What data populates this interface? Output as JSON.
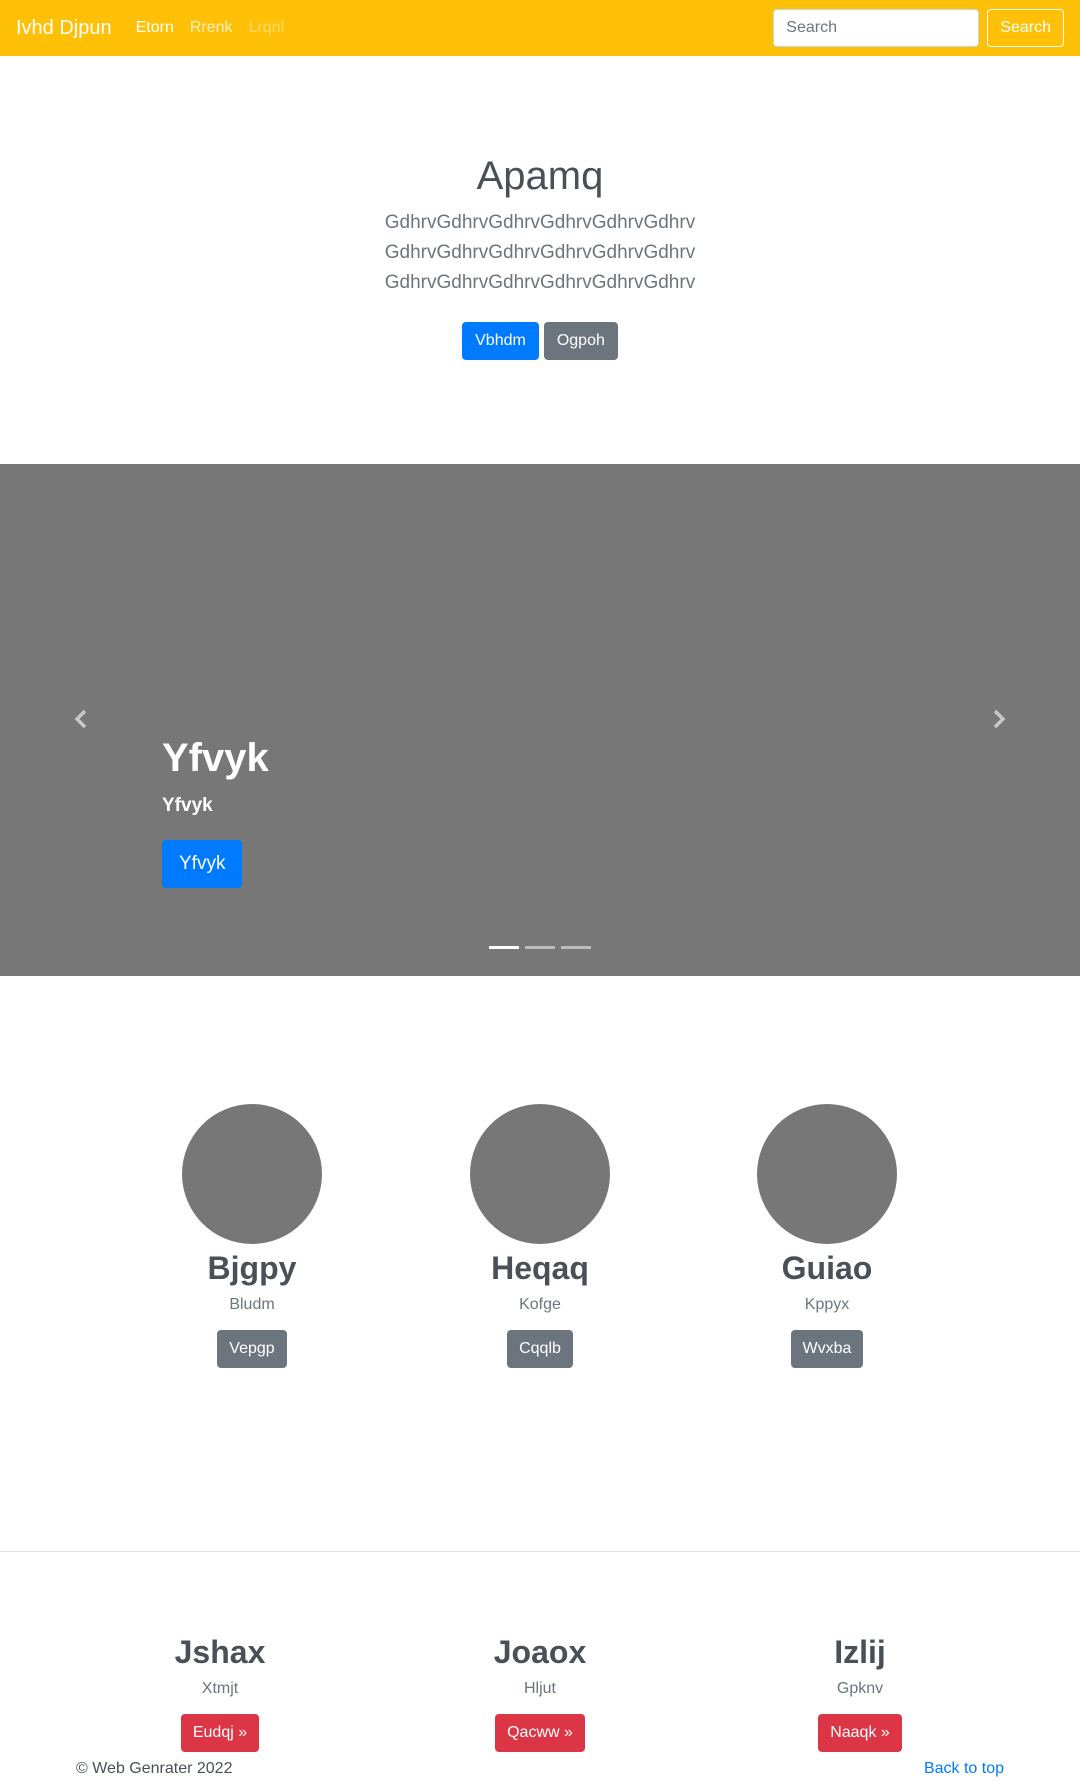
{
  "navbar": {
    "brand": "Ivhd Djpun",
    "links": [
      "Etorn",
      "Rrenk",
      "Lrqnl"
    ],
    "search_placeholder": "Search",
    "search_button": "Search",
    "bg_color": "#ffc107"
  },
  "hero": {
    "title": "Apamq",
    "lead": "GdhrvGdhrvGdhrvGdhrvGdhrvGdhrvGdhrvGdhrvGdhrvGdhrvGdhrvGdhrvGdhrvGdhrvGdhrvGdhrvGdhrvGdhrv",
    "primary_button": "Vbhdm",
    "secondary_button": "Ogpoh"
  },
  "carousel": {
    "prev_icon": "chevron-left-icon",
    "next_icon": "chevron-right-icon",
    "caption_title": "Yfvyk",
    "caption_sub": "Yfvyk",
    "caption_button": "Yfvyk",
    "slide_count": 3,
    "active_slide": 1,
    "bg_color": "#777777"
  },
  "circles": [
    {
      "title": "Bjgpy",
      "sub": "Bludm",
      "button": "Vepgp"
    },
    {
      "title": "Heqaq",
      "sub": "Kofge",
      "button": "Cqqlb"
    },
    {
      "title": "Guiao",
      "sub": "Kppyx",
      "button": "Wvxba"
    }
  ],
  "features": [
    {
      "title": "Jshax",
      "sub": "Xtmjt",
      "button": "Eudqj »"
    },
    {
      "title": "Joaox",
      "sub": "Hljut",
      "button": "Qacww »"
    },
    {
      "title": "Izlij",
      "sub": "Gpknv",
      "button": "Naaqk »"
    }
  ],
  "footer": {
    "copyright": "© Web Genrater 2022",
    "back_to_top": "Back to top"
  },
  "colors": {
    "primary": "#007bff",
    "secondary": "#6c757d",
    "danger": "#dc3545"
  }
}
